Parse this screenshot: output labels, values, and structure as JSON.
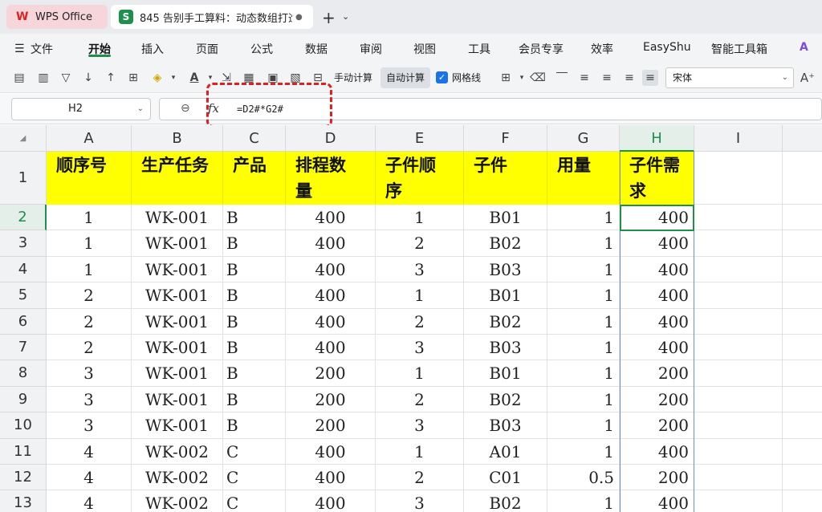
{
  "titlebar": {
    "tabs": [
      {
        "label": "WPS Office",
        "icon": "wps-logo-icon"
      },
      {
        "label": "845 告别手工算料：动态数组打造",
        "icon": "spreadsheet-icon",
        "unsaved_dot": "●"
      }
    ],
    "new_tab": "+",
    "tabs_menu": "⌄"
  },
  "menubar": {
    "file_label": "文件",
    "items": [
      "开始",
      "插入",
      "页面",
      "公式",
      "数据",
      "审阅",
      "视图",
      "工具",
      "会员专享",
      "效率",
      "EasyShu",
      "智能工具箱"
    ],
    "active": "开始"
  },
  "toolbar": {
    "manual_calc": "手动计算",
    "auto_calc": "自动计算",
    "gridlines": "网格线",
    "gridlines_checked": true,
    "font_name": "宋体"
  },
  "formula_bar": {
    "name_box": "H2",
    "formula": "=D2#*G2#"
  },
  "sheet": {
    "columns": [
      "A",
      "B",
      "C",
      "D",
      "E",
      "F",
      "G",
      "H",
      "I"
    ],
    "selected_column": "H",
    "selected_row": "2",
    "header_row": {
      "row_number": "1",
      "cells": [
        [
          "顺序号"
        ],
        [
          "生产任务"
        ],
        [
          "产品"
        ],
        [
          "排程数",
          "量"
        ],
        [
          "子件顺",
          "序"
        ],
        [
          "子件"
        ],
        [
          "用量"
        ],
        [
          "子件需",
          "求"
        ]
      ]
    },
    "rows": [
      {
        "n": "2",
        "cells": [
          "1",
          "WK-001",
          "B",
          "400",
          "1",
          "B01",
          "1",
          "400"
        ]
      },
      {
        "n": "3",
        "cells": [
          "1",
          "WK-001",
          "B",
          "400",
          "2",
          "B02",
          "1",
          "400"
        ]
      },
      {
        "n": "4",
        "cells": [
          "1",
          "WK-001",
          "B",
          "400",
          "3",
          "B03",
          "1",
          "400"
        ]
      },
      {
        "n": "5",
        "cells": [
          "2",
          "WK-001",
          "B",
          "400",
          "1",
          "B01",
          "1",
          "400"
        ]
      },
      {
        "n": "6",
        "cells": [
          "2",
          "WK-001",
          "B",
          "400",
          "2",
          "B02",
          "1",
          "400"
        ]
      },
      {
        "n": "7",
        "cells": [
          "2",
          "WK-001",
          "B",
          "400",
          "3",
          "B03",
          "1",
          "400"
        ]
      },
      {
        "n": "8",
        "cells": [
          "3",
          "WK-001",
          "B",
          "200",
          "1",
          "B01",
          "1",
          "200"
        ]
      },
      {
        "n": "9",
        "cells": [
          "3",
          "WK-001",
          "B",
          "200",
          "2",
          "B02",
          "1",
          "200"
        ]
      },
      {
        "n": "10",
        "cells": [
          "3",
          "WK-001",
          "B",
          "200",
          "3",
          "B03",
          "1",
          "200"
        ]
      },
      {
        "n": "11",
        "cells": [
          "4",
          "WK-002",
          "C",
          "400",
          "1",
          "A01",
          "1",
          "400"
        ]
      },
      {
        "n": "12",
        "cells": [
          "4",
          "WK-002",
          "C",
          "400",
          "2",
          "C01",
          "0.5",
          "200"
        ]
      },
      {
        "n": "13",
        "cells": [
          "4",
          "WK-002",
          "C",
          "400",
          "3",
          "B02",
          "1",
          "400"
        ]
      }
    ]
  },
  "colors": {
    "accent": "#1f8f4e",
    "header_fill": "#ffff00",
    "annotation_red": "#e02020"
  }
}
